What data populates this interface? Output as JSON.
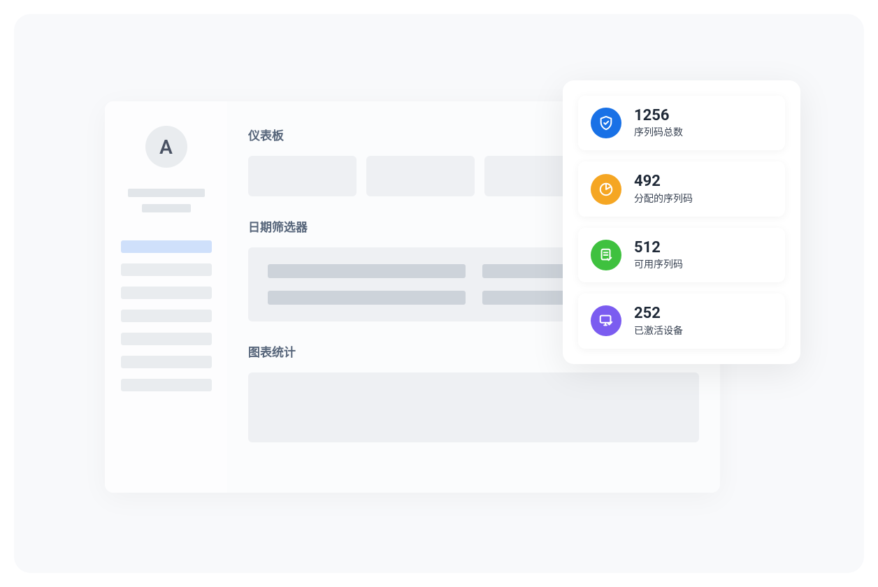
{
  "sidebar": {
    "avatar_letter": "A"
  },
  "sections": {
    "dashboard_title": "仪表板",
    "date_filter_title": "日期筛选器",
    "chart_stats_title": "图表统计"
  },
  "stats": [
    {
      "value": "1256",
      "label": "序列码总数",
      "icon": "shield-check",
      "color": "blue"
    },
    {
      "value": "492",
      "label": "分配的序列码",
      "icon": "pie-chart",
      "color": "orange"
    },
    {
      "value": "512",
      "label": "可用序列码",
      "icon": "document-check",
      "color": "green"
    },
    {
      "value": "252",
      "label": "已激活设备",
      "icon": "monitor-check",
      "color": "purple"
    }
  ]
}
